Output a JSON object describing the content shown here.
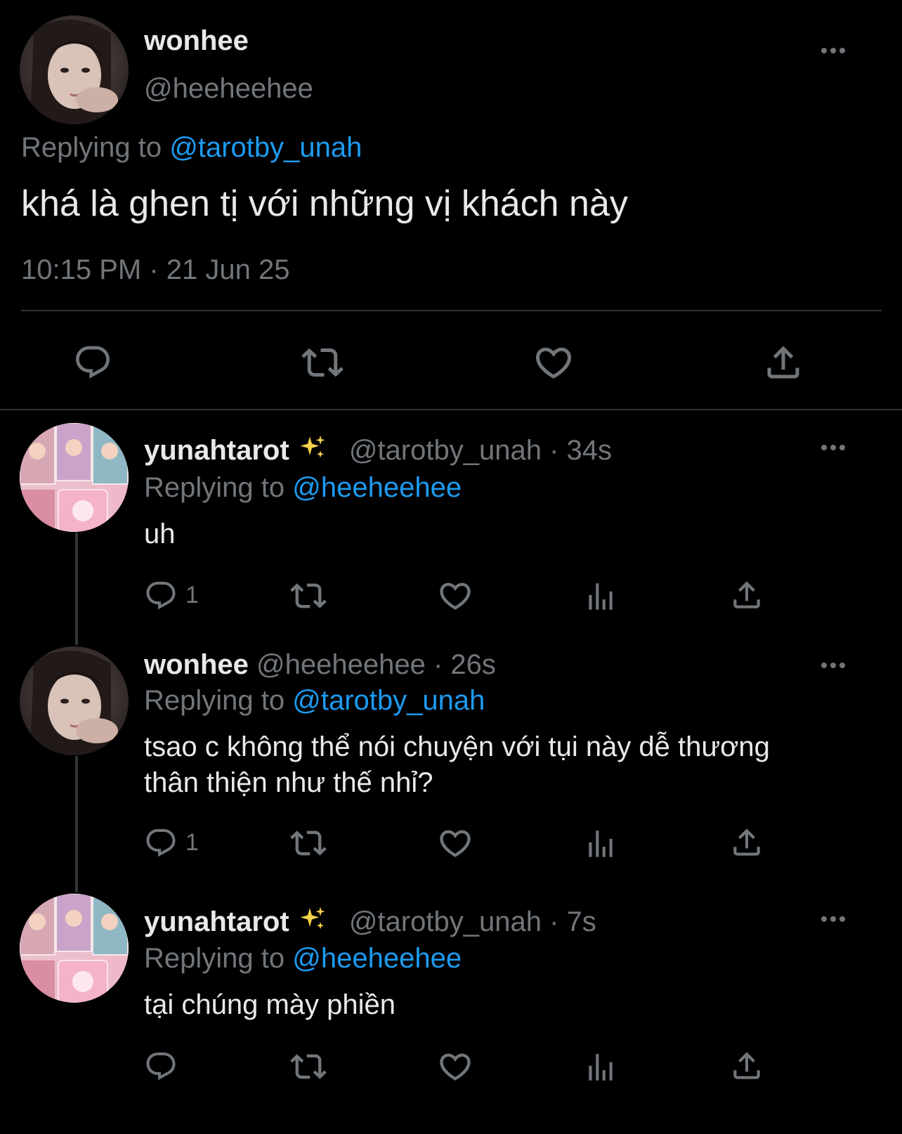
{
  "main_tweet": {
    "display_name": "wonhee",
    "handle": "@heeheehee",
    "replying_prefix": "Replying to",
    "replying_to": "@tarotby_unah",
    "text": "khá là ghen tị với những vị khách này",
    "timestamp": "10:15 PM · 21 Jun 25"
  },
  "replies": [
    {
      "display_name": "yunahtarot",
      "emoji": "sparkles-icon",
      "handle": "@tarotby_unah",
      "time": "· 34s",
      "replying_prefix": "Replying to",
      "replying_to": "@heeheehee",
      "text": "uh",
      "reply_count": "1"
    },
    {
      "display_name": "wonhee",
      "handle": "@heeheehee",
      "time": "· 26s",
      "replying_prefix": "Replying to",
      "replying_to": "@tarotby_unah",
      "text_line1": "tsao c không thể nói chuyện với tụi này dễ thương",
      "text_line2": "thân thiện như thế nhỉ?",
      "reply_count": "1"
    },
    {
      "display_name": "yunahtarot",
      "emoji": "sparkles-icon",
      "handle": "@tarotby_unah",
      "time": "· 7s",
      "replying_prefix": "Replying to",
      "replying_to": "@heeheehee",
      "text": "tại chúng mày phiền"
    }
  ],
  "colors": {
    "background": "#000000",
    "text": "#e7e9ea",
    "muted": "#71767b",
    "link": "#1d9bf0",
    "divider": "#2f3336"
  }
}
